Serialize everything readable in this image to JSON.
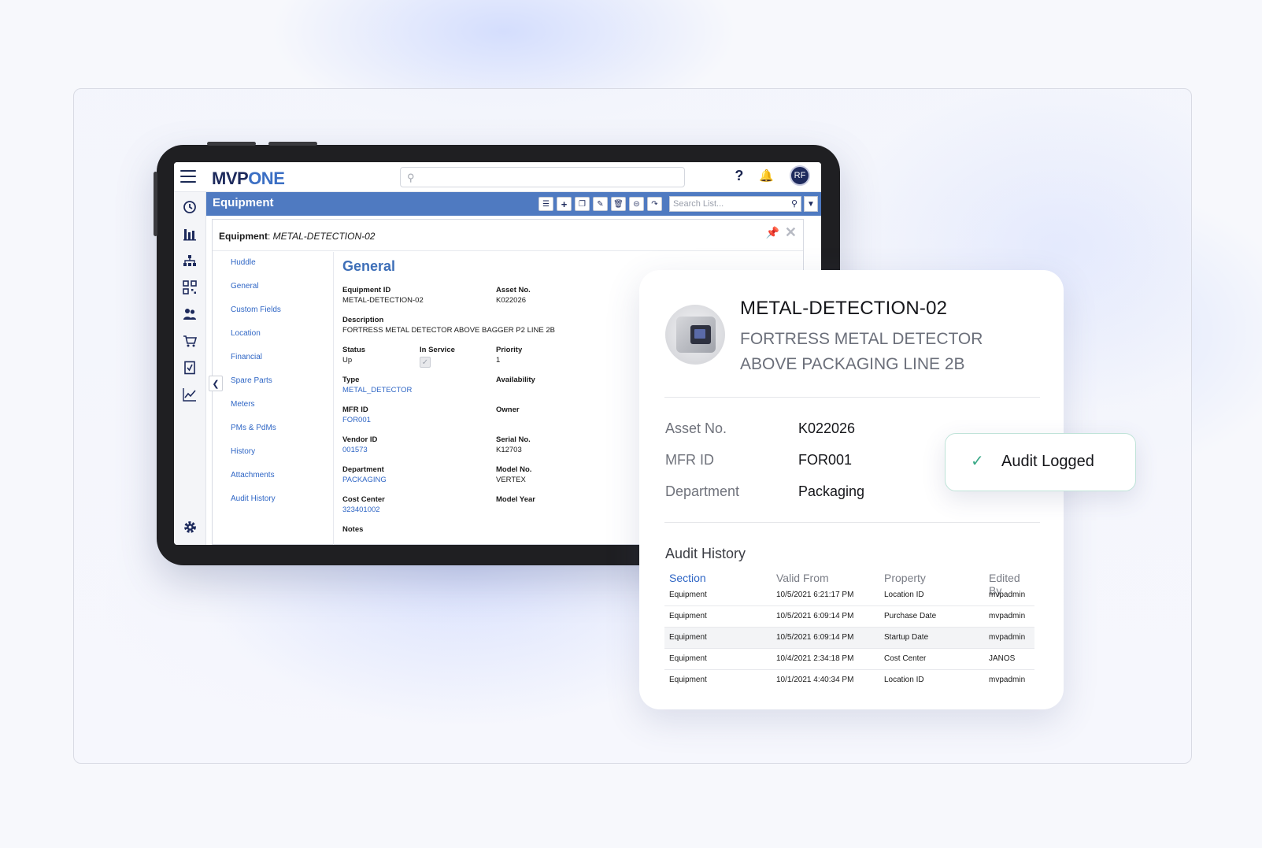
{
  "app": {
    "logo_part1": "MVP",
    "logo_part2": "ONE",
    "avatar_initials": "RF",
    "help_label": "?"
  },
  "module": {
    "title": "Equipment",
    "search_placeholder": "Search List...",
    "toolbar_icons": [
      "list-icon",
      "add-icon",
      "copy-icon",
      "edit-icon",
      "delete-icon",
      "minus-icon",
      "export-icon"
    ]
  },
  "sidebar_icons": [
    "history-icon",
    "bar-chart-icon",
    "hierarchy-icon",
    "qr-code-icon",
    "users-icon",
    "cart-icon",
    "checklist-icon",
    "trend-icon",
    "settings-icon"
  ],
  "dialog": {
    "label": "Equipment",
    "record": "METAL-DETECTION-02",
    "nav": [
      "Huddle",
      "General",
      "Custom Fields",
      "Location",
      "Financial",
      "Spare Parts",
      "Meters",
      "PMs & PdMs",
      "History",
      "Attachments",
      "Audit History"
    ],
    "section_title": "General",
    "fields": {
      "equipment_id_label": "Equipment ID",
      "equipment_id": "METAL-DETECTION-02",
      "asset_no_label": "Asset No.",
      "asset_no": "K022026",
      "description_label": "Description",
      "description": "FORTRESS METAL DETECTOR ABOVE BAGGER P2 LINE 2B",
      "status_label": "Status",
      "status": "Up",
      "in_service_label": "In Service",
      "priority_label": "Priority",
      "priority": "1",
      "type_label": "Type",
      "type": "METAL_DETECTOR",
      "availability_label": "Availability",
      "mfr_id_label": "MFR ID",
      "mfr_id": "FOR001",
      "owner_label": "Owner",
      "vendor_id_label": "Vendor ID",
      "vendor_id": "001573",
      "serial_no_label": "Serial No.",
      "serial_no": "K12703",
      "department_label": "Department",
      "department": "PACKAGING",
      "model_no_label": "Model No.",
      "model_no": "VERTEX",
      "cost_center_label": "Cost Center",
      "cost_center": "323401002",
      "model_year_label": "Model Year",
      "notes_label": "Notes"
    }
  },
  "card": {
    "title": "METAL-DETECTION-02",
    "description": "FORTRESS METAL DETECTOR ABOVE PACKAGING LINE 2B",
    "details": [
      {
        "label": "Asset No.",
        "value": "K022026"
      },
      {
        "label": "MFR ID",
        "value": "FOR001"
      },
      {
        "label": "Department",
        "value": "Packaging"
      }
    ],
    "audit_title": "Audit History",
    "audit_headers": [
      "Section",
      "Valid From",
      "Property",
      "Edited By"
    ],
    "audit_rows": [
      [
        "Equipment",
        "10/5/2021 6:21:17 PM",
        "Location ID",
        "mvpadmin"
      ],
      [
        "Equipment",
        "10/5/2021 6:09:14 PM",
        "Purchase Date",
        "mvpadmin"
      ],
      [
        "Equipment",
        "10/5/2021 6:09:14 PM",
        "Startup Date",
        "mvpadmin"
      ],
      [
        "Equipment",
        "10/4/2021 2:34:18 PM",
        "Cost Center",
        "JANOS"
      ],
      [
        "Equipment",
        "10/1/2021 4:40:34 PM",
        "Location ID",
        "mvpadmin"
      ]
    ]
  },
  "toast": {
    "message": "Audit Logged"
  },
  "colors": {
    "brand_navy": "#1d2a5c",
    "brand_blue": "#4f7ac1",
    "link_blue": "#2f66c5",
    "success_green": "#3aa987"
  }
}
